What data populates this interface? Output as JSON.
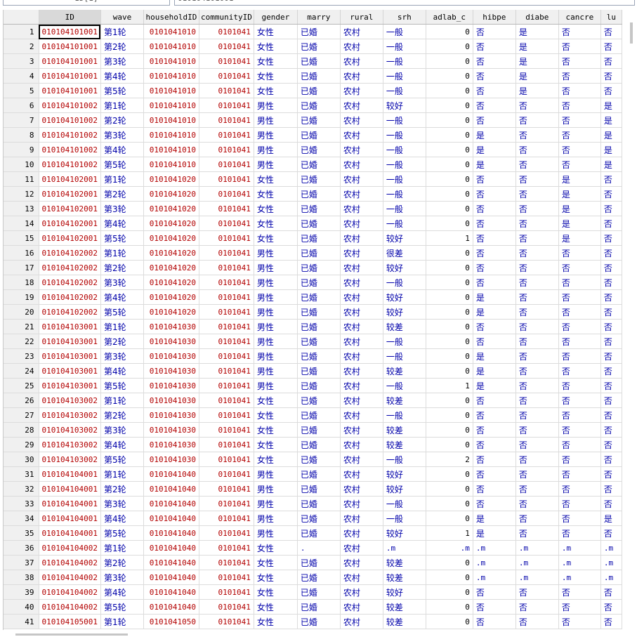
{
  "toolbar": {
    "cell_name": "ID[1]",
    "cell_value": "010104101001"
  },
  "columns": [
    "ID",
    "wave",
    "householdID",
    "communityID",
    "gender",
    "marry",
    "rural",
    "srh",
    "adlab_c",
    "hibpe",
    "diabe",
    "cancre",
    "lu"
  ],
  "rows": [
    [
      "010104101001",
      "第1轮",
      "0101041010",
      "0101041",
      "女性",
      "已婚",
      "农村",
      "一般",
      "0",
      "否",
      "是",
      "否",
      "否"
    ],
    [
      "010104101001",
      "第2轮",
      "0101041010",
      "0101041",
      "女性",
      "已婚",
      "农村",
      "一般",
      "0",
      "否",
      "是",
      "否",
      "否"
    ],
    [
      "010104101001",
      "第3轮",
      "0101041010",
      "0101041",
      "女性",
      "已婚",
      "农村",
      "一般",
      "0",
      "否",
      "是",
      "否",
      "否"
    ],
    [
      "010104101001",
      "第4轮",
      "0101041010",
      "0101041",
      "女性",
      "已婚",
      "农村",
      "一般",
      "0",
      "否",
      "是",
      "否",
      "否"
    ],
    [
      "010104101001",
      "第5轮",
      "0101041010",
      "0101041",
      "女性",
      "已婚",
      "农村",
      "一般",
      "0",
      "否",
      "是",
      "否",
      "否"
    ],
    [
      "010104101002",
      "第1轮",
      "0101041010",
      "0101041",
      "男性",
      "已婚",
      "农村",
      "较好",
      "0",
      "否",
      "否",
      "否",
      "是"
    ],
    [
      "010104101002",
      "第2轮",
      "0101041010",
      "0101041",
      "男性",
      "已婚",
      "农村",
      "一般",
      "0",
      "否",
      "否",
      "否",
      "是"
    ],
    [
      "010104101002",
      "第3轮",
      "0101041010",
      "0101041",
      "男性",
      "已婚",
      "农村",
      "一般",
      "0",
      "是",
      "否",
      "否",
      "是"
    ],
    [
      "010104101002",
      "第4轮",
      "0101041010",
      "0101041",
      "男性",
      "已婚",
      "农村",
      "一般",
      "0",
      "是",
      "否",
      "否",
      "是"
    ],
    [
      "010104101002",
      "第5轮",
      "0101041010",
      "0101041",
      "男性",
      "已婚",
      "农村",
      "一般",
      "0",
      "是",
      "否",
      "否",
      "是"
    ],
    [
      "010104102001",
      "第1轮",
      "0101041020",
      "0101041",
      "女性",
      "已婚",
      "农村",
      "一般",
      "0",
      "否",
      "否",
      "是",
      "否"
    ],
    [
      "010104102001",
      "第2轮",
      "0101041020",
      "0101041",
      "女性",
      "已婚",
      "农村",
      "一般",
      "0",
      "否",
      "否",
      "是",
      "否"
    ],
    [
      "010104102001",
      "第3轮",
      "0101041020",
      "0101041",
      "女性",
      "已婚",
      "农村",
      "一般",
      "0",
      "否",
      "否",
      "是",
      "否"
    ],
    [
      "010104102001",
      "第4轮",
      "0101041020",
      "0101041",
      "女性",
      "已婚",
      "农村",
      "一般",
      "0",
      "否",
      "否",
      "是",
      "否"
    ],
    [
      "010104102001",
      "第5轮",
      "0101041020",
      "0101041",
      "女性",
      "已婚",
      "农村",
      "较好",
      "1",
      "否",
      "否",
      "是",
      "否"
    ],
    [
      "010104102002",
      "第1轮",
      "0101041020",
      "0101041",
      "男性",
      "已婚",
      "农村",
      "很差",
      "0",
      "否",
      "否",
      "否",
      "否"
    ],
    [
      "010104102002",
      "第2轮",
      "0101041020",
      "0101041",
      "男性",
      "已婚",
      "农村",
      "较好",
      "0",
      "否",
      "否",
      "否",
      "否"
    ],
    [
      "010104102002",
      "第3轮",
      "0101041020",
      "0101041",
      "男性",
      "已婚",
      "农村",
      "一般",
      "0",
      "否",
      "否",
      "否",
      "否"
    ],
    [
      "010104102002",
      "第4轮",
      "0101041020",
      "0101041",
      "男性",
      "已婚",
      "农村",
      "较好",
      "0",
      "是",
      "否",
      "否",
      "否"
    ],
    [
      "010104102002",
      "第5轮",
      "0101041020",
      "0101041",
      "男性",
      "已婚",
      "农村",
      "较好",
      "0",
      "是",
      "否",
      "否",
      "否"
    ],
    [
      "010104103001",
      "第1轮",
      "0101041030",
      "0101041",
      "男性",
      "已婚",
      "农村",
      "较差",
      "0",
      "否",
      "否",
      "否",
      "否"
    ],
    [
      "010104103001",
      "第2轮",
      "0101041030",
      "0101041",
      "男性",
      "已婚",
      "农村",
      "一般",
      "0",
      "否",
      "否",
      "否",
      "否"
    ],
    [
      "010104103001",
      "第3轮",
      "0101041030",
      "0101041",
      "男性",
      "已婚",
      "农村",
      "一般",
      "0",
      "是",
      "否",
      "否",
      "否"
    ],
    [
      "010104103001",
      "第4轮",
      "0101041030",
      "0101041",
      "男性",
      "已婚",
      "农村",
      "较差",
      "0",
      "是",
      "否",
      "否",
      "否"
    ],
    [
      "010104103001",
      "第5轮",
      "0101041030",
      "0101041",
      "男性",
      "已婚",
      "农村",
      "一般",
      "1",
      "是",
      "否",
      "否",
      "否"
    ],
    [
      "010104103002",
      "第1轮",
      "0101041030",
      "0101041",
      "女性",
      "已婚",
      "农村",
      "较差",
      "0",
      "否",
      "否",
      "否",
      "否"
    ],
    [
      "010104103002",
      "第2轮",
      "0101041030",
      "0101041",
      "女性",
      "已婚",
      "农村",
      "一般",
      "0",
      "否",
      "否",
      "否",
      "否"
    ],
    [
      "010104103002",
      "第3轮",
      "0101041030",
      "0101041",
      "女性",
      "已婚",
      "农村",
      "较差",
      "0",
      "否",
      "否",
      "否",
      "否"
    ],
    [
      "010104103002",
      "第4轮",
      "0101041030",
      "0101041",
      "女性",
      "已婚",
      "农村",
      "较差",
      "0",
      "否",
      "否",
      "否",
      "否"
    ],
    [
      "010104103002",
      "第5轮",
      "0101041030",
      "0101041",
      "女性",
      "已婚",
      "农村",
      "一般",
      "2",
      "否",
      "否",
      "否",
      "否"
    ],
    [
      "010104104001",
      "第1轮",
      "0101041040",
      "0101041",
      "男性",
      "已婚",
      "农村",
      "较好",
      "0",
      "否",
      "否",
      "否",
      "否"
    ],
    [
      "010104104001",
      "第2轮",
      "0101041040",
      "0101041",
      "男性",
      "已婚",
      "农村",
      "较好",
      "0",
      "否",
      "否",
      "否",
      "否"
    ],
    [
      "010104104001",
      "第3轮",
      "0101041040",
      "0101041",
      "男性",
      "已婚",
      "农村",
      "一般",
      "0",
      "否",
      "否",
      "否",
      "否"
    ],
    [
      "010104104001",
      "第4轮",
      "0101041040",
      "0101041",
      "男性",
      "已婚",
      "农村",
      "一般",
      "0",
      "是",
      "否",
      "否",
      "是"
    ],
    [
      "010104104001",
      "第5轮",
      "0101041040",
      "0101041",
      "男性",
      "已婚",
      "农村",
      "较好",
      "1",
      "是",
      "否",
      "否",
      "否"
    ],
    [
      "010104104002",
      "第1轮",
      "0101041040",
      "0101041",
      "女性",
      ".",
      "农村",
      ".m",
      ".m",
      ".m",
      ".m",
      ".m",
      ".m"
    ],
    [
      "010104104002",
      "第2轮",
      "0101041040",
      "0101041",
      "女性",
      "已婚",
      "农村",
      "较差",
      "0",
      ".m",
      ".m",
      ".m",
      ".m"
    ],
    [
      "010104104002",
      "第3轮",
      "0101041040",
      "0101041",
      "女性",
      "已婚",
      "农村",
      "较差",
      "0",
      ".m",
      ".m",
      ".m",
      ".m"
    ],
    [
      "010104104002",
      "第4轮",
      "0101041040",
      "0101041",
      "女性",
      "已婚",
      "农村",
      "较好",
      "0",
      "否",
      "否",
      "否",
      "否"
    ],
    [
      "010104104002",
      "第5轮",
      "0101041040",
      "0101041",
      "女性",
      "已婚",
      "农村",
      "较差",
      "0",
      "否",
      "否",
      "否",
      "否"
    ],
    [
      "010104105001",
      "第1轮",
      "0101041050",
      "0101041",
      "女性",
      "已婚",
      "农村",
      "较差",
      "0",
      "否",
      "否",
      "否",
      "否"
    ]
  ]
}
